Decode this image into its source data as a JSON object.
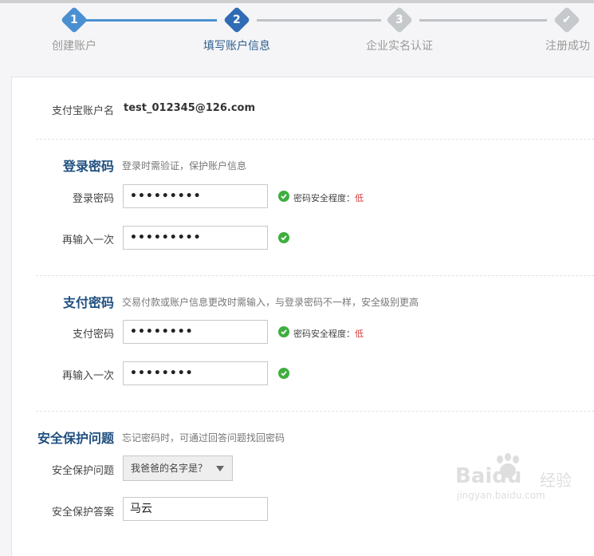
{
  "steps": [
    {
      "num": "1",
      "label": "创建账户",
      "state": "done"
    },
    {
      "num": "2",
      "label": "填写账户信息",
      "state": "current"
    },
    {
      "num": "3",
      "label": "企业实名认证",
      "state": "todo"
    },
    {
      "num": "✔",
      "label": "注册成功",
      "state": "todo"
    }
  ],
  "account": {
    "label": "支付宝账户名",
    "value": "test_012345@126.com"
  },
  "login": {
    "title": "登录密码",
    "desc": "登录时需验证，保护账户信息",
    "pwd_label": "登录密码",
    "pwd_value": "•••••••••",
    "confirm_label": "再输入一次",
    "confirm_value": "•••••••••",
    "strength_prefix": "密码安全程度：",
    "strength_level": "低"
  },
  "pay": {
    "title": "支付密码",
    "desc": "交易付款或账户信息更改时需输入，与登录密码不一样，安全级别更高",
    "pwd_label": "支付密码",
    "pwd_value": "••••••••",
    "confirm_label": "再输入一次",
    "confirm_value": "••••••••",
    "strength_prefix": "密码安全程度：",
    "strength_level": "低"
  },
  "security": {
    "title": "安全保护问题",
    "desc": "忘记密码时，可通过回答问题找回密码",
    "question_label": "安全保护问题",
    "question_value": "我爸爸的名字是？",
    "answer_label": "安全保护答案",
    "answer_value": "马云"
  },
  "watermark": {
    "brand": "Baidu",
    "cn": "经验",
    "url": "jingyan.baidu.com"
  },
  "colors": {
    "step_done": "#4a8fd1",
    "step_current": "#2f6cb4",
    "step_todo": "#c6c9cc",
    "check": "#3fae3f",
    "low": "#d23b3b"
  }
}
